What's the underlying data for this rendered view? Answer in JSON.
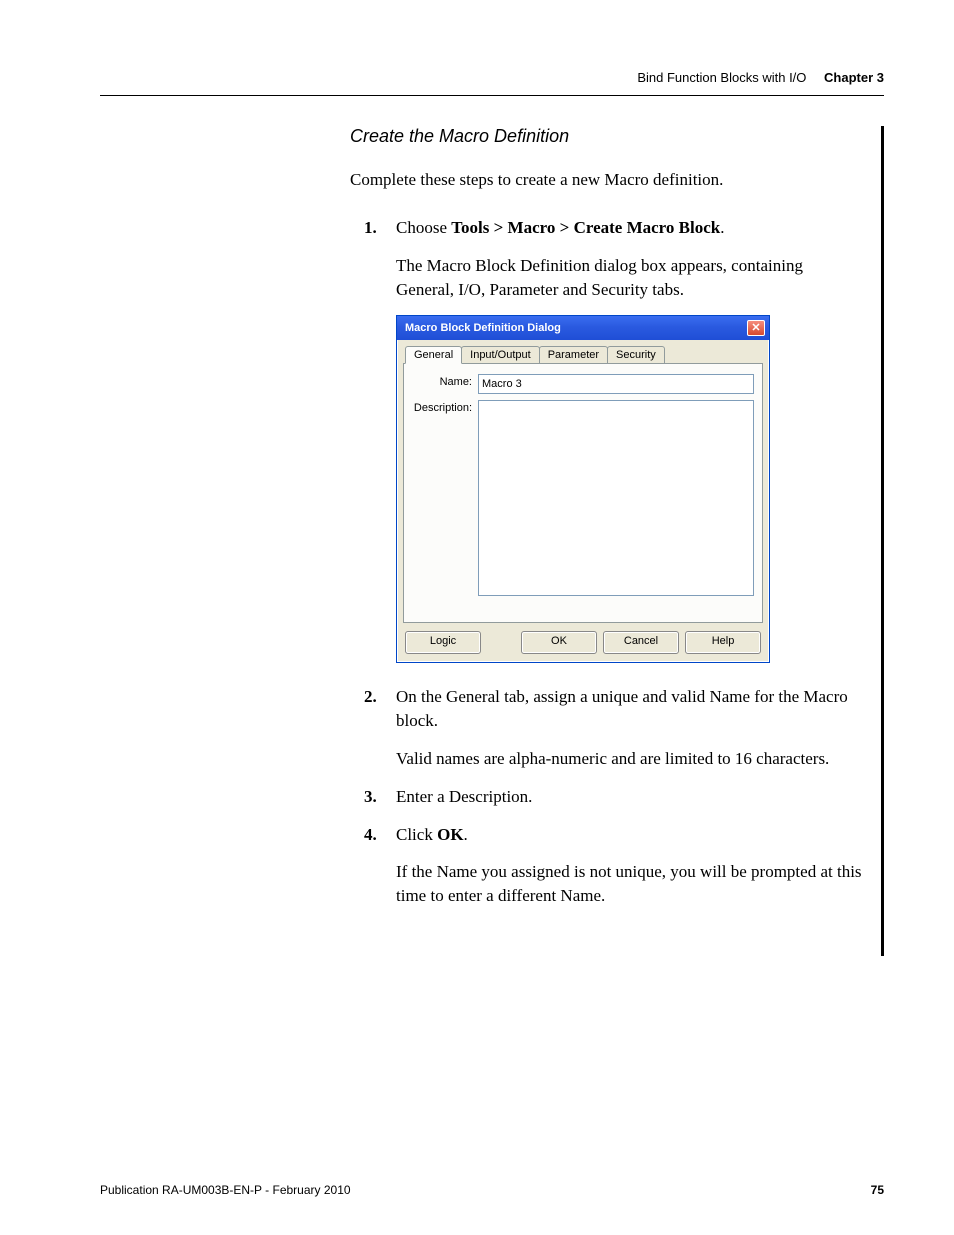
{
  "header": {
    "section": "Bind Function Blocks with I/O",
    "chapter": "Chapter 3"
  },
  "heading": "Create the Macro Definition",
  "intro": "Complete these steps to create a new Macro definition.",
  "steps": [
    {
      "num": "1.",
      "text_prefix": "Choose ",
      "bold": "Tools > Macro > Create Macro Block",
      "text_suffix": ".",
      "follow": "The Macro Block Definition dialog box appears, containing General, I/O, Parameter and Security tabs."
    },
    {
      "num": "2.",
      "text": "On the General tab, assign a unique and valid Name for the Macro block.",
      "follow": "Valid names are alpha-numeric and are limited to 16 characters."
    },
    {
      "num": "3.",
      "text": "Enter a Description."
    },
    {
      "num": "4.",
      "text_prefix": "Click ",
      "bold": "OK",
      "text_suffix": ".",
      "follow": "If the Name you assigned is not unique, you will be prompted at this time to enter a different Name."
    }
  ],
  "dialog": {
    "title": "Macro Block Definition Dialog",
    "close_glyph": "✕",
    "tabs": [
      "General",
      "Input/Output",
      "Parameter",
      "Security"
    ],
    "name_label": "Name:",
    "name_value": "Macro 3",
    "desc_label": "Description:",
    "desc_value": "",
    "buttons": {
      "logic": "Logic",
      "ok": "OK",
      "cancel": "Cancel",
      "help": "Help"
    }
  },
  "footer": {
    "pub": "Publication RA-UM003B-EN-P - February 2010",
    "page": "75"
  }
}
